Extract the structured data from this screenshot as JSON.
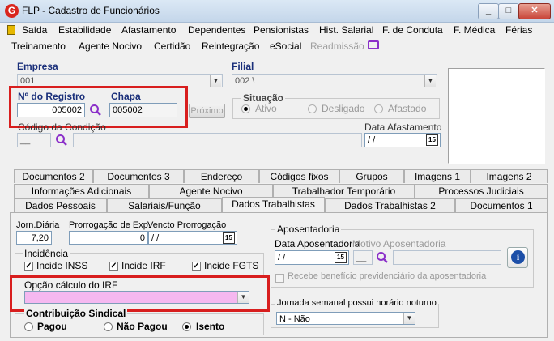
{
  "window": {
    "title": "FLP - Cadastro de Funcionários",
    "app_icon": "G"
  },
  "menu_row1": [
    "Saída",
    "Estabilidade",
    "Afastamento",
    "Dependentes",
    "Pensionistas",
    "Hist. Salarial",
    "F. de Conduta",
    "F. Médica",
    "Férias"
  ],
  "menu_row2": [
    "Treinamento",
    "Agente Nocivo",
    "Certidão",
    "Reintegração",
    "eSocial",
    "Readmissão"
  ],
  "empresa": {
    "label": "Empresa",
    "value": "001"
  },
  "filial": {
    "label": "Filial",
    "value": "002 \\"
  },
  "registro": {
    "label": "Nº do Registro",
    "value": "005002"
  },
  "chapa": {
    "label": "Chapa",
    "value": "005002"
  },
  "proximo_label": "Próximo",
  "situacao": {
    "label": "Situação",
    "options": [
      "Ativo",
      "Desligado",
      "Afastado"
    ],
    "selected": "Ativo"
  },
  "codigo_condicao": {
    "label": "Código da Condição",
    "value": "__"
  },
  "data_afastamento": {
    "label": "Data Afastamento",
    "value": " /  /"
  },
  "tabs_row1": [
    "Documentos 2",
    "Documentos 3",
    "Endereço",
    "Códigos fixos",
    "Grupos",
    "Imagens 1",
    "Imagens 2"
  ],
  "tabs_row2": [
    "Informações Adicionais",
    "Agente Nocivo",
    "Trabalhador Temporário",
    "Processos Judiciais"
  ],
  "tabs_row3": [
    "Dados Pessoais",
    "Salariais/Função",
    "Dados Trabalhistas",
    "Dados Trabalhistas 2",
    "Documentos 1"
  ],
  "active_tab": "Dados Trabalhistas",
  "jornada": {
    "label": "Jorn.Diária",
    "value": "7,20"
  },
  "prorrogacao": {
    "label": "Prorrogação de Exp.",
    "value": "0"
  },
  "vencto": {
    "label": "Vencto Prorrogação",
    "value": " /  /"
  },
  "incidencia": {
    "label": "Incidência",
    "items": [
      "Incide INSS",
      "Incide IRF",
      "Incide FGTS"
    ]
  },
  "opcao_irf": {
    "label": "Opção cálculo do IRF",
    "value": ""
  },
  "contribuicao": {
    "label": "Contribuição Sindical",
    "options": [
      "Pagou",
      "Não Pagou",
      "Isento"
    ],
    "selected": "Isento"
  },
  "aposentadoria": {
    "label": "Aposentadoria",
    "data_label": "Data Aposentadoria",
    "data_value": " /  /",
    "motivo_label": "Motivo Aposentadoria",
    "motivo_value": "__",
    "beneficio_label": "Recebe benefício previdenciário da aposentadoria"
  },
  "jornada_noturna": {
    "label": "Jornada semanal possui horário noturno",
    "value": "N - Não"
  },
  "colors": {
    "highlight_red": "#d81e1e",
    "irf_field": "#f5b8f0",
    "accent_purple": "#8b2fc9"
  }
}
